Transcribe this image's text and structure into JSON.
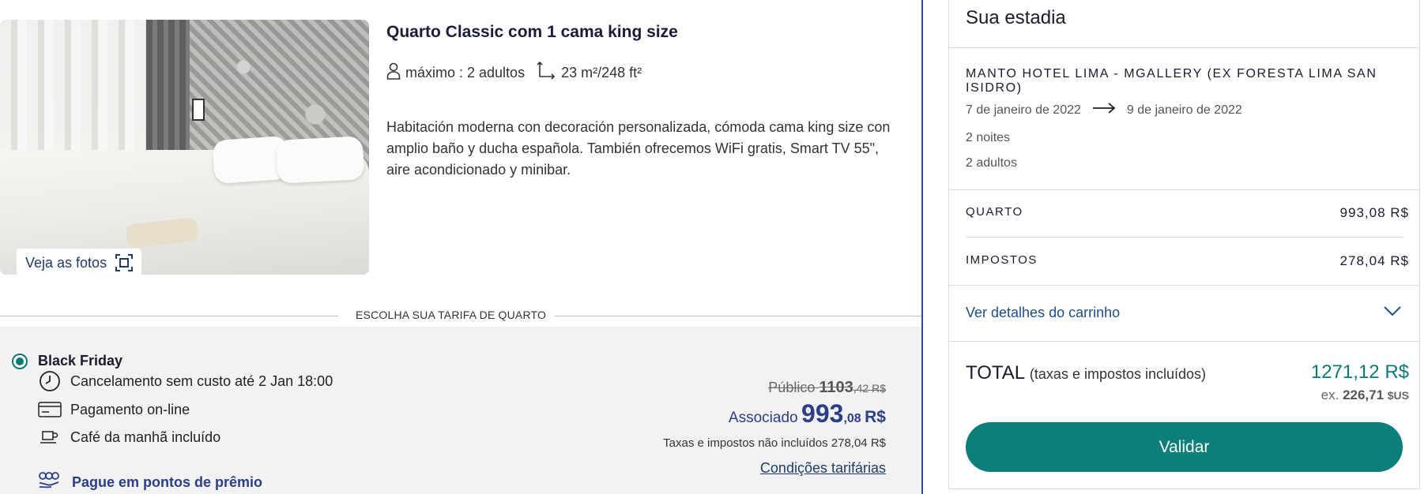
{
  "room": {
    "photos_button": "Veja as fotos",
    "title": "Quarto Classic com 1 cama king size",
    "capacity": "máximo : 2 adultos",
    "size": "23 m²/248 ft²",
    "description": "Habitación moderna con decoración personalizada, cómoda cama king size con amplio baño y ducha española. También ofrecemos WiFi gratis, Smart TV 55\", aire acondicionado y minibar."
  },
  "tariff": {
    "heading": "ESCOLHA SUA TARIFA DE QUARTO",
    "rate_name": "Black Friday",
    "features": [
      {
        "icon": "clock-icon",
        "label": "Cancelamento sem custo até 2 Jan 18:00"
      },
      {
        "icon": "credit-card-icon",
        "label": "Pagamento on-line"
      },
      {
        "icon": "coffee-cup-icon",
        "label": "Café da manhã incluído"
      }
    ],
    "points_link": "Pague em pontos de prêmio",
    "public_label": "Público",
    "public_price_int": "1103",
    "public_price_dec": ",42 R$",
    "member_label": "Associado",
    "member_price_int": "993",
    "member_price_dec": ",08",
    "member_currency": "R$",
    "tax_note": "Taxas e impostos não incluídos 278,04 R$",
    "conditions_link": "Condições tarifárias"
  },
  "stay": {
    "title": "Sua estadia",
    "hotel_name": "MANTO HOTEL LIMA - MGALLERY (EX FORESTA LIMA SAN ISIDRO)",
    "check_in": "7 de janeiro de 2022",
    "check_out": "9 de janeiro de 2022",
    "nights": "2 noites",
    "guests": "2 adultos",
    "room_label": "QUARTO",
    "room_value": "993,08 R$",
    "taxes_label": "IMPOSTOS",
    "taxes_value": "278,04 R$",
    "cart_link": "Ver detalhes do carrinho",
    "total_label": "TOTAL",
    "total_note": "(taxas e impostos incluídos)",
    "total_value": "1271,12 R$",
    "total_usd_prefix": "ex.",
    "total_usd_value": "226,71",
    "total_usd_currency": "$US",
    "validate_button": "Validar"
  },
  "colors": {
    "accent_teal": "#0b7f79",
    "link_blue": "#1d4f8a",
    "member_blue": "#2b3e8a"
  }
}
